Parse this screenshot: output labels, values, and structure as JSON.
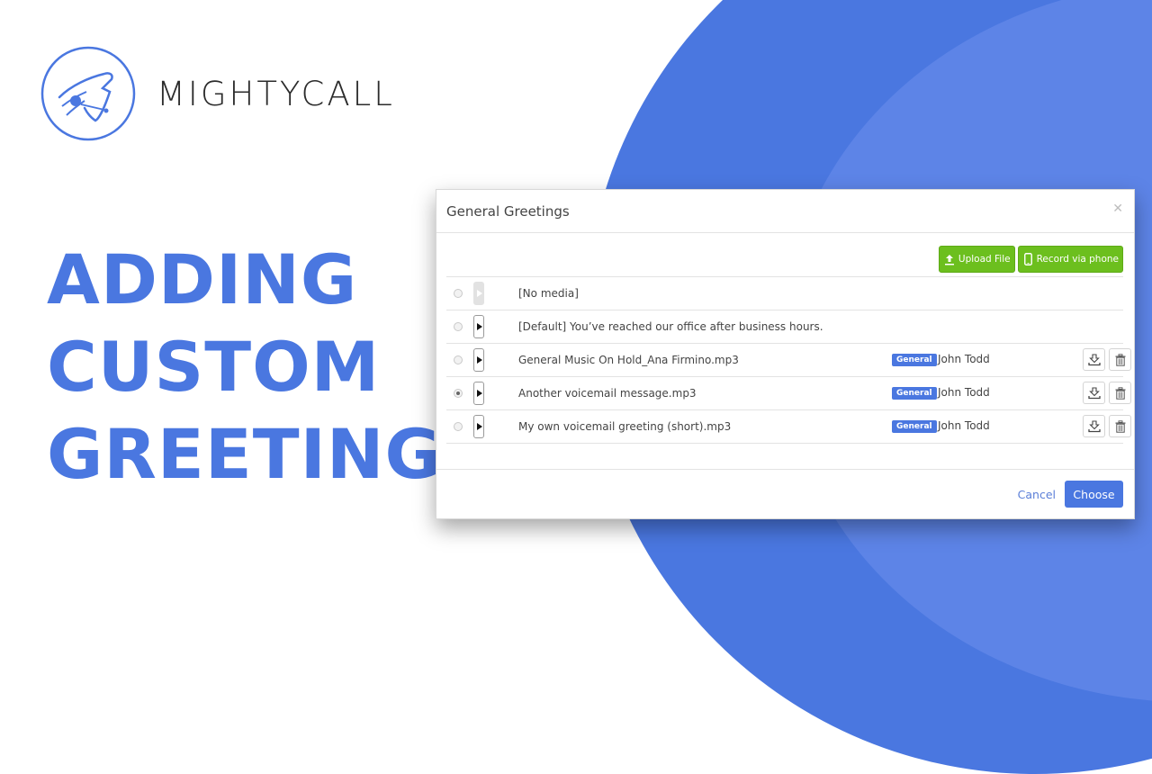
{
  "brand": {
    "name": "MIGHTYCALL",
    "icon": "mightycall-logo-icon",
    "accent": "#4a77e0"
  },
  "headline": {
    "lines": [
      "ADDING",
      "CUSTOM",
      "GREETING"
    ]
  },
  "modal": {
    "title": "General Greetings",
    "close_icon": "close-icon",
    "toolbar": {
      "upload_label": "Upload File",
      "upload_icon": "upload-icon",
      "record_label": "Record via phone",
      "record_icon": "phone-icon",
      "color": "#6cbf1e"
    },
    "rows": [
      {
        "name": "[No media]",
        "selected": false,
        "playable": false,
        "tag": "",
        "owner": ""
      },
      {
        "name": "[Default] You’ve reached our office after business hours.",
        "selected": false,
        "playable": true,
        "tag": "",
        "owner": ""
      },
      {
        "name": "General Music On Hold_Ana Firmino.mp3",
        "selected": false,
        "playable": true,
        "tag": "General",
        "owner": "John Todd"
      },
      {
        "name": "Another voicemail message.mp3",
        "selected": true,
        "playable": true,
        "tag": "General",
        "owner": "John Todd"
      },
      {
        "name": "My own voicemail greeting (short).mp3",
        "selected": false,
        "playable": true,
        "tag": "General",
        "owner": "John Todd"
      }
    ],
    "footer": {
      "cancel_label": "Cancel",
      "choose_label": "Choose"
    }
  }
}
